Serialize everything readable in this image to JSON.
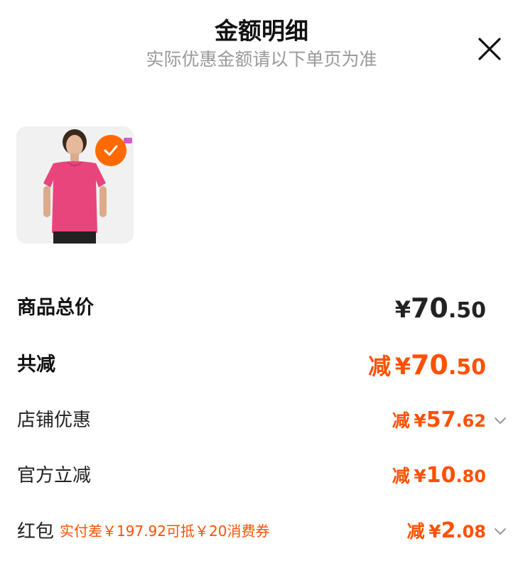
{
  "header": {
    "title": "金额明细",
    "subtitle": "实际优惠金额请以下单页为准"
  },
  "icons": {
    "close": "close-icon",
    "check": "check-icon",
    "chevron": "chevron-down-icon"
  },
  "colors": {
    "accent": "#ff5000",
    "check_badge": "#ff6a00",
    "subtitle": "#999999"
  },
  "product": {
    "selected": true
  },
  "summary": {
    "total": {
      "label": "商品总价",
      "currency": "¥",
      "integer": "70",
      "decimal": ".50"
    },
    "total_discount": {
      "label": "共减",
      "prefix": "减",
      "currency": "¥",
      "integer": "70",
      "decimal": ".50"
    },
    "store_discount": {
      "label": "店铺优惠",
      "prefix": "减",
      "currency": "¥",
      "integer": "57",
      "decimal": ".62"
    },
    "official_discount": {
      "label": "官方立减",
      "prefix": "减",
      "currency": "¥",
      "integer": "10",
      "decimal": ".80"
    },
    "red_packet": {
      "label": "红包",
      "hint": "实付差￥197.92可抵￥20消费券",
      "prefix": "减",
      "currency": "¥",
      "integer": "2",
      "decimal": ".08"
    }
  }
}
